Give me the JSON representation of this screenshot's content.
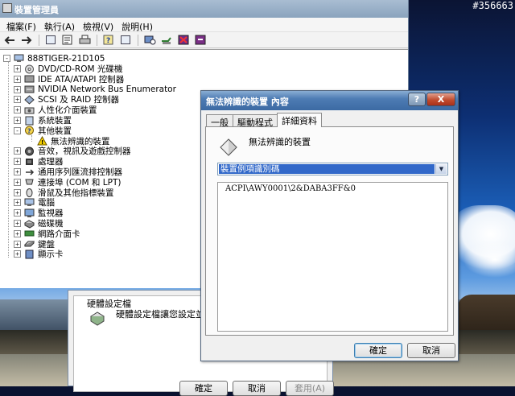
{
  "watermark": "#356663",
  "device_manager": {
    "title": "裝置管理員",
    "menu": [
      "檔案(F)",
      "執行(A)",
      "檢視(V)",
      "說明(H)"
    ],
    "toolbar_icons": [
      "back-arrow-icon",
      "forward-arrow-icon",
      "console-tree-icon",
      "properties-icon",
      "print-icon",
      "help-icon",
      "show-hidden-icon",
      "scan-hardware-icon",
      "update-driver-icon",
      "disable-device-icon",
      "uninstall-device-icon"
    ],
    "root": "888TIGER-21D105",
    "items": [
      {
        "label": "DVD/CD-ROM 光碟機",
        "expander": "+",
        "icon": "dvd-icon"
      },
      {
        "label": "IDE ATA/ATAPI 控制器",
        "expander": "+",
        "icon": "ide-controller-icon"
      },
      {
        "label": "NVIDIA Network Bus Enumerator",
        "expander": "+",
        "icon": "network-bus-icon"
      },
      {
        "label": "SCSI 及 RAID 控制器",
        "expander": "+",
        "icon": "scsi-controller-icon"
      },
      {
        "label": "人性化介面裝置",
        "expander": "+",
        "icon": "hid-icon"
      },
      {
        "label": "系統裝置",
        "expander": "+",
        "icon": "system-device-icon"
      },
      {
        "label": "其他裝置",
        "expander": "-",
        "icon": "other-device-icon"
      },
      {
        "label": "無法辨識的裝置",
        "expander": "",
        "icon": "unknown-device-warning-icon",
        "child": true
      },
      {
        "label": "音效，視訊及遊戲控制器",
        "expander": "+",
        "icon": "sound-icon"
      },
      {
        "label": "處理器",
        "expander": "+",
        "icon": "processor-icon"
      },
      {
        "label": "通用序列匯流排控制器",
        "expander": "+",
        "icon": "usb-controller-icon"
      },
      {
        "label": "連接埠 (COM 和 LPT)",
        "expander": "+",
        "icon": "port-icon"
      },
      {
        "label": "滑鼠及其他指標裝置",
        "expander": "+",
        "icon": "mouse-icon"
      },
      {
        "label": "電腦",
        "expander": "+",
        "icon": "computer-icon"
      },
      {
        "label": "監視器",
        "expander": "+",
        "icon": "monitor-icon"
      },
      {
        "label": "磁碟機",
        "expander": "+",
        "icon": "disk-drive-icon"
      },
      {
        "label": "網路介面卡",
        "expander": "+",
        "icon": "network-adapter-icon"
      },
      {
        "label": "鍵盤",
        "expander": "+",
        "icon": "keyboard-icon"
      },
      {
        "label": "顯示卡",
        "expander": "+",
        "icon": "display-adapter-icon"
      }
    ]
  },
  "hardware_window": {
    "heading": "硬體設定檔",
    "description": "硬體設定檔讓您設定並儲",
    "buttons": {
      "ok": "確定",
      "cancel": "取消",
      "apply": "套用(A)"
    }
  },
  "properties_dialog": {
    "title": "無法辨識的裝置 內容",
    "caption_buttons": {
      "help": "?",
      "close": "X"
    },
    "tabs": [
      "一般",
      "驅動程式",
      "詳細資料"
    ],
    "active_tab": "詳細資料",
    "device_name": "無法辨識的裝置",
    "property_selected": "裝置例項識別碼",
    "value": "ACPI\\AWY0001\\2&DABA3FF&0",
    "ok_label": "確定",
    "cancel_label": "取消"
  }
}
